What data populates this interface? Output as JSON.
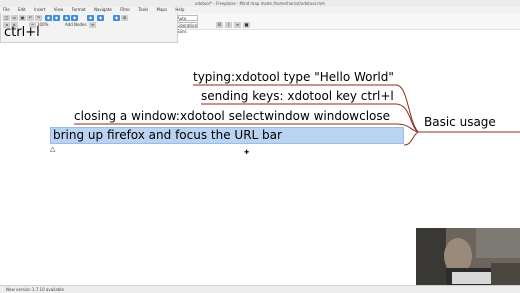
{
  "window": {
    "title": "xdotool* - Freeplane - Mind map mode /home/harisd/xdotool.mm"
  },
  "menubar": {
    "items": [
      "File",
      "Edit",
      "Insert",
      "View",
      "Format",
      "Navigate",
      "Filter",
      "Tools",
      "Maps",
      "Help"
    ]
  },
  "toolbar": {
    "zoom_value": "100%",
    "font_value": "Default",
    "font_name": "Liberation Sans",
    "filter_value": "Auto",
    "add_nodes_label": "Add Nodes",
    "bold_label": "B",
    "italic_label": "I"
  },
  "editor": {
    "text": "ctrl+l"
  },
  "mindmap": {
    "root": "Basic usage",
    "nodes": [
      "typing:xdotool type \"Hello World\"",
      "sending keys: xdotool key ctrl+l",
      "closing a window:xdotool selectwindow windowclose",
      "bring up firefox and focus the URL bar"
    ]
  },
  "status": {
    "text": "New version 1.7.10 available"
  },
  "colors": {
    "edge": "#8b2d1a",
    "selection": "#b9d3f1"
  }
}
